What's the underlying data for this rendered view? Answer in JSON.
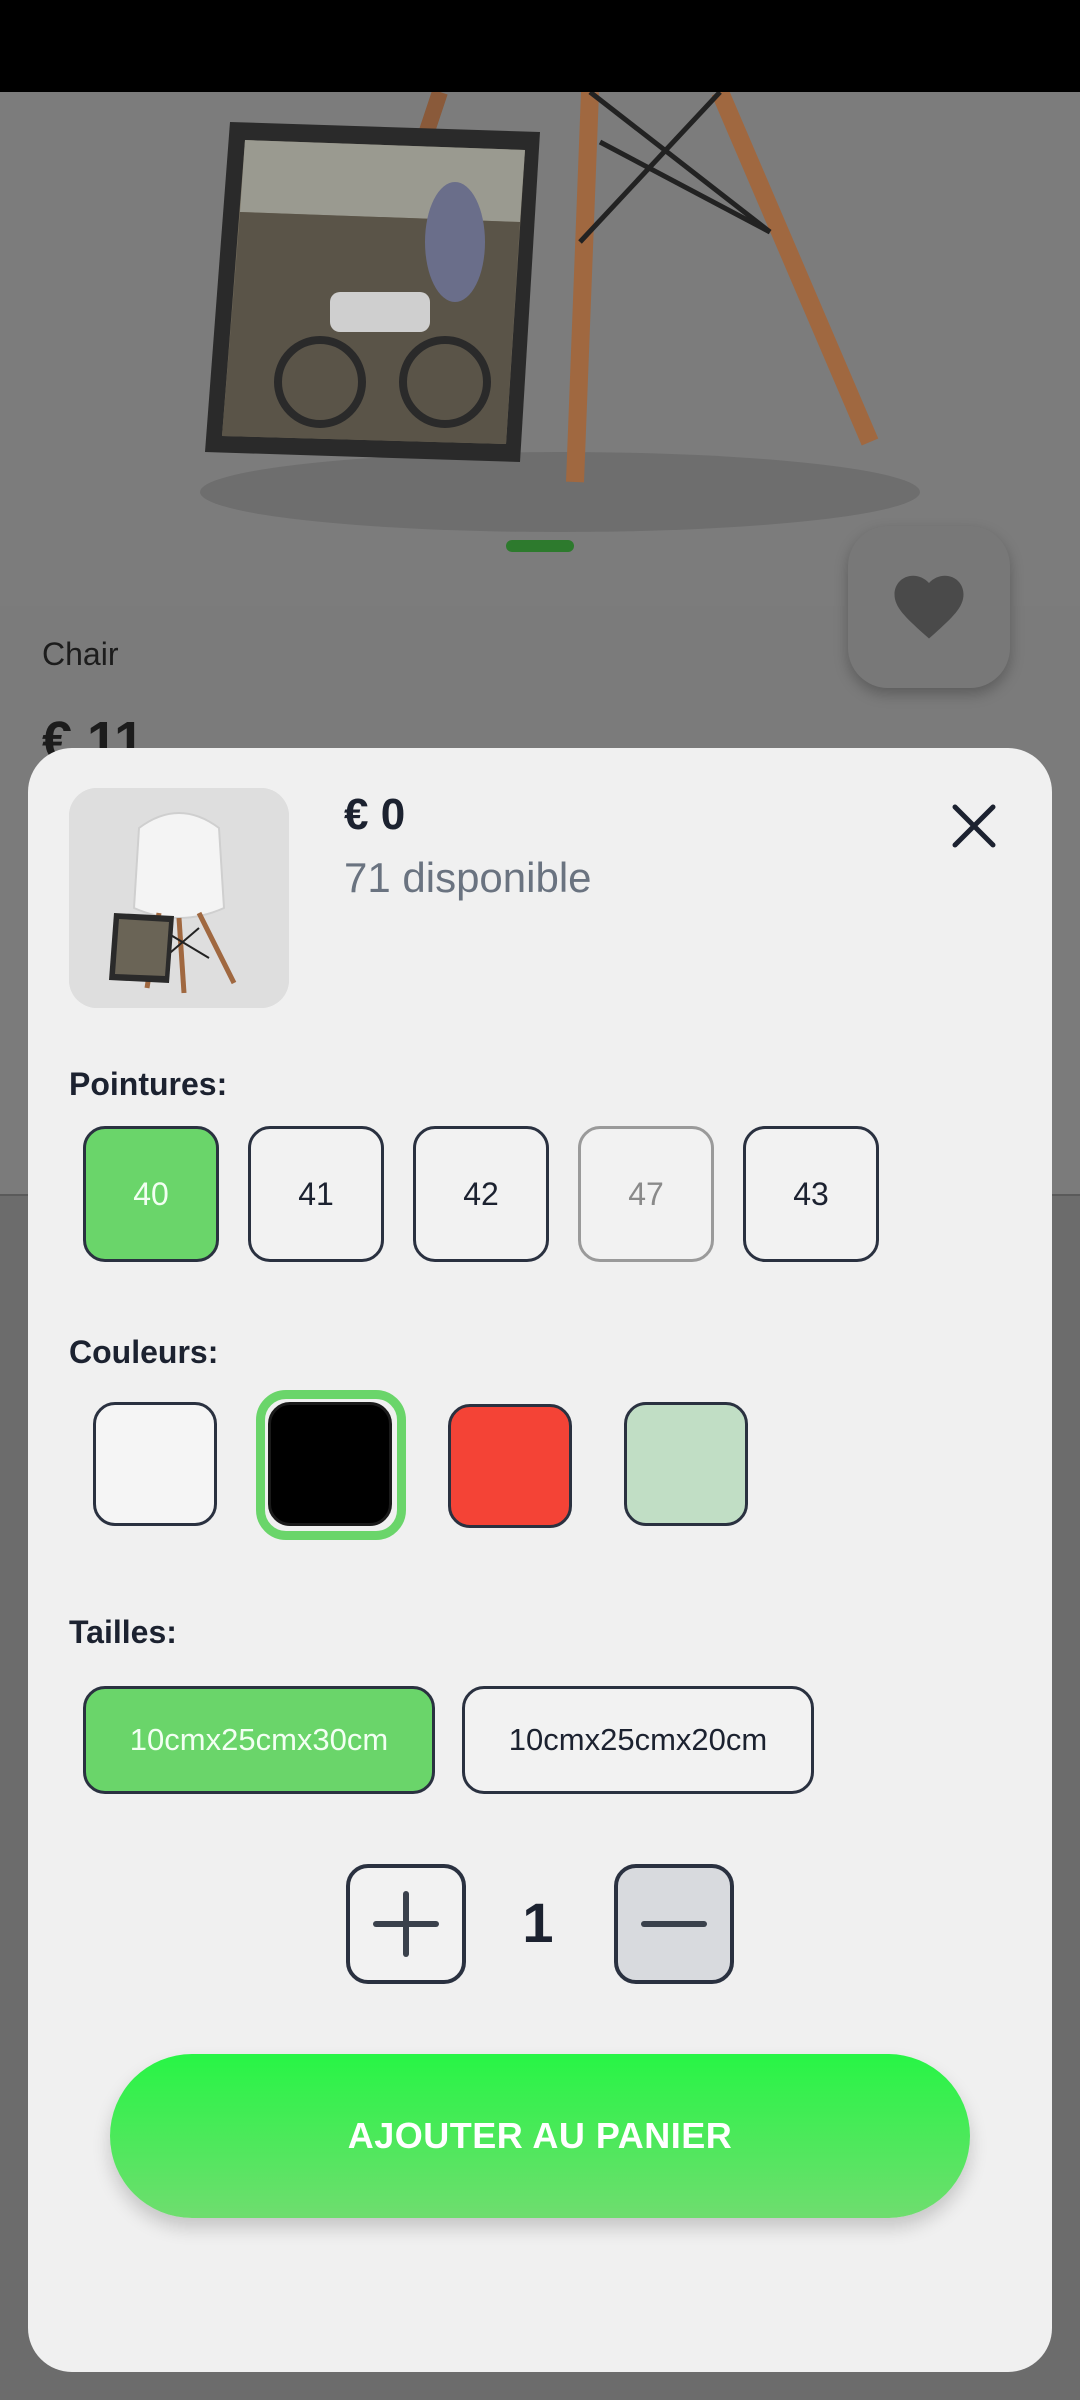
{
  "product": {
    "name": "Chair",
    "price": "€ 11"
  },
  "sheet": {
    "price": "€ 0",
    "stock": "71 disponible",
    "sizes_label": "Pointures:",
    "sizes": [
      {
        "label": "40",
        "state": "selected"
      },
      {
        "label": "41",
        "state": "normal"
      },
      {
        "label": "42",
        "state": "normal"
      },
      {
        "label": "47",
        "state": "disabled"
      },
      {
        "label": "43",
        "state": "normal"
      }
    ],
    "colors_label": "Couleurs:",
    "colors": [
      {
        "hex": "#f5f5f5",
        "selected": false
      },
      {
        "hex": "#000000",
        "selected": true
      },
      {
        "hex": "#f44336",
        "selected": false
      },
      {
        "hex": "#c1dec5",
        "selected": false
      }
    ],
    "dimensions_label": "Tailles:",
    "dimensions": [
      {
        "label": "10cmx25cmx30cm",
        "selected": true
      },
      {
        "label": "10cmx25cmx20cm",
        "selected": false
      }
    ],
    "quantity": "1",
    "add_to_cart_label": "AJOUTER AU PANIER"
  },
  "icons": {
    "favorite": "heart-icon",
    "close": "close-icon",
    "increment": "plus-icon",
    "decrement": "minus-icon"
  },
  "theme": {
    "accent": "#6ad56a",
    "button_gradient_top": "#27f545",
    "button_gradient_bottom": "#6fdd6f"
  }
}
